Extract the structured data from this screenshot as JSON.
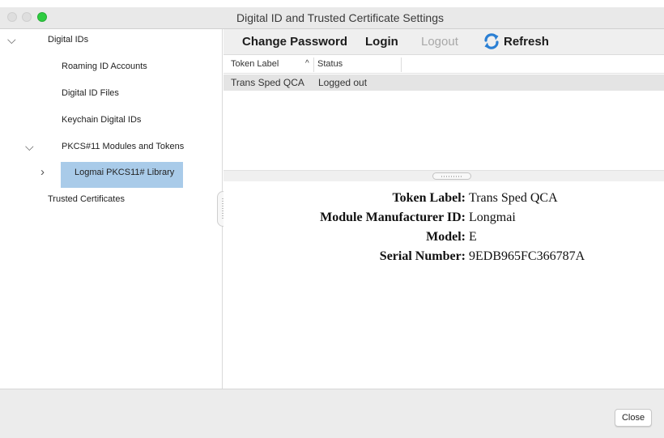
{
  "window": {
    "title": "Digital ID and Trusted Certificate Settings"
  },
  "sidebar": {
    "items": [
      {
        "label": "Digital IDs",
        "expanded": true
      },
      {
        "label": "Roaming ID Accounts"
      },
      {
        "label": "Digital ID Files"
      },
      {
        "label": "Keychain Digital IDs"
      },
      {
        "label": "PKCS#11 Modules and Tokens",
        "expanded": true
      },
      {
        "label": "Logmai PKCS11# Library",
        "selected": true,
        "expanded": false
      },
      {
        "label": "Trusted Certificates"
      }
    ]
  },
  "toolbar": {
    "change_password": "Change Password",
    "login": "Login",
    "logout": "Logout",
    "refresh": "Refresh"
  },
  "table": {
    "columns": [
      "Token Label",
      "Status"
    ],
    "sort_indicator": "^",
    "rows": [
      {
        "token_label": "Trans Sped QCA",
        "status": "Logged out"
      }
    ]
  },
  "details": {
    "token_label_label": "Token Label:",
    "token_label_value": "Trans Sped QCA",
    "manufacturer_label": "Module Manufacturer ID:",
    "manufacturer_value": "Longmai",
    "model_label": "Model:",
    "model_value": "E",
    "serial_label": "Serial Number:",
    "serial_value": "9EDB965FC366787A"
  },
  "footer": {
    "close_label": "Close"
  },
  "colors": {
    "selection": "#a9cbe9",
    "refresh_icon": "#2a7fd4",
    "maximize_button": "#2ecc40"
  }
}
